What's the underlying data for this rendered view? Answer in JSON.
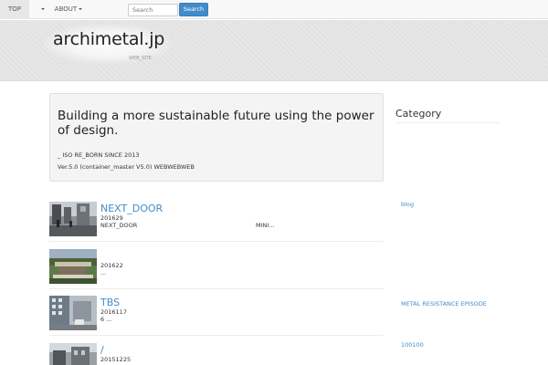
{
  "nav": {
    "top_label": "TOP",
    "about_label": "ABOUT"
  },
  "search": {
    "placeholder": "Search",
    "button_label": "Search"
  },
  "header": {
    "site_title": "archimetal.jp",
    "subtitle": "WEB_SITE"
  },
  "intro": {
    "heading": "Building a more sustainable future using the power of design.",
    "line1": "_ ISO RE_BORN SINCE 2013",
    "line2": "Ver.5.0 (container_master V5.0) WEBWEBWEB"
  },
  "posts": [
    {
      "title": "NEXT_DOOR",
      "date": "201629",
      "excerpt": "NEXT_DOOR",
      "excerpt_right": "MINI..."
    },
    {
      "title": "",
      "date": "201622",
      "excerpt": "..."
    },
    {
      "title": "TBS",
      "date": "2016117",
      "excerpt": "6 ..."
    },
    {
      "title": "/",
      "date": "20151225",
      "excerpt": ""
    }
  ],
  "sidebar": {
    "title": "Category",
    "links": [
      "blog",
      "METAL RESISTANCE EPISODE",
      "100100"
    ]
  },
  "colors": {
    "link": "#428bca",
    "button": "#428bca",
    "navbar_bg": "#f8f8f8",
    "header_bg": "#e6e6e6",
    "panel_bg": "#f4f4f4"
  }
}
